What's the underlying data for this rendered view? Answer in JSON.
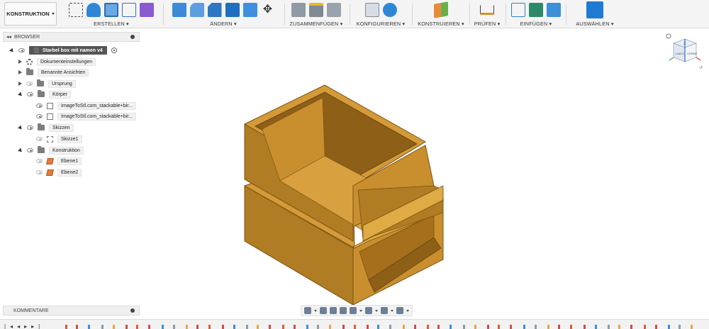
{
  "workspace": {
    "label": "KONSTRUKTION"
  },
  "toolbar_groups": [
    {
      "label": "ERSTELLEN"
    },
    {
      "label": "ÄNDERN"
    },
    {
      "label": "ZUSAMMENFÜGEN"
    },
    {
      "label": "KONFIGURIEREN"
    },
    {
      "label": "KONSTRUIEREN"
    },
    {
      "label": "PRÜFEN"
    },
    {
      "label": "EINFÜGEN"
    },
    {
      "label": "AUSWÄHLEN"
    }
  ],
  "browser": {
    "header": "BROWSER",
    "root": "Starbel box mit namen v4",
    "items": [
      {
        "label": "Dokumenteinstellungen"
      },
      {
        "label": "Benannte Ansichten"
      },
      {
        "label": "Ursprung"
      },
      {
        "label": "Körper"
      },
      {
        "label": "ImageToStl.com_stackable+bir..."
      },
      {
        "label": "ImageToStl.com_stackable+bir..."
      },
      {
        "label": "Skizzen"
      },
      {
        "label": "Skizze1"
      },
      {
        "label": "Konstruktion"
      },
      {
        "label": "Ebene1"
      },
      {
        "label": "Ebene2"
      }
    ]
  },
  "comments": {
    "label": "KOMMENTARE"
  },
  "viewcube": {
    "left_label": "LINKS",
    "right_label": "VORNE",
    "axis_label": "Z"
  },
  "colors": {
    "model": "#c98f2e",
    "model_dark": "#8e5f17",
    "model_light": "#e0aa45",
    "accent": "#1f7bd1"
  }
}
